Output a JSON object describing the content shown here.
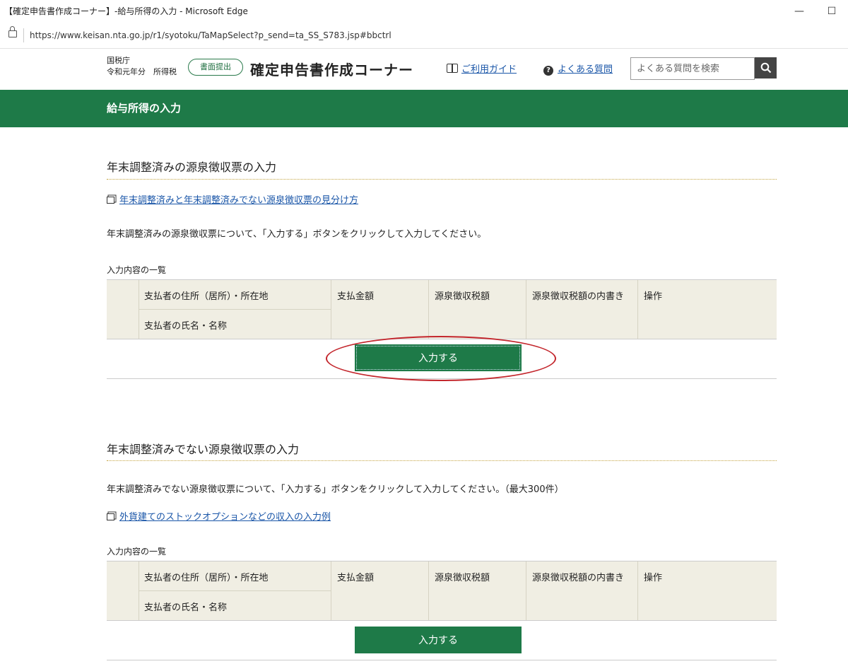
{
  "window": {
    "title": "【確定申告書作成コーナー】-給与所得の入力 - Microsoft Edge",
    "minimize": "—",
    "maximize": "☐",
    "url": "https://www.keisan.nta.go.jp/r1/syotoku/TaMapSelect?p_send=ta_SS_S783.jsp#bbctrl"
  },
  "header": {
    "agency_line1": "国税庁",
    "agency_line2": "令和元年分　所得税",
    "submit_pill": "書面提出",
    "brand": "確定申告書作成コーナー",
    "guide_link": "ご利用ガイド",
    "faq_icon": "?",
    "faq_link": "よくある質問",
    "search_placeholder": "よくある質問を検索"
  },
  "page_title": "給与所得の入力",
  "section1": {
    "title": "年末調整済みの源泉徴収票の入力",
    "link": "年末調整済みと年末調整済みでない源泉徴収票の見分け方",
    "instruction": "年末調整済みの源泉徴収票について、「入力する」ボタンをクリックして入力してください。",
    "table_label": "入力内容の一覧",
    "button": "入力する"
  },
  "section2": {
    "title": "年末調整済みでない源泉徴収票の入力",
    "instruction": "年末調整済みでない源泉徴収票について、「入力する」ボタンをクリックして入力してください。（最大300件）",
    "link": "外貨建てのストックオプションなどの収入の入力例",
    "table_label": "入力内容の一覧",
    "button": "入力する"
  },
  "table_headers": {
    "address": "支払者の住所（居所）・所在地",
    "name": "支払者の氏名・名称",
    "amount": "支払金額",
    "tax": "源泉徴収税額",
    "tax_breakdown": "源泉徴収税額の内書き",
    "action": "操作"
  },
  "colors": {
    "brand_green": "#1e7a48",
    "link_blue": "#1a56a8",
    "highlight_red": "#c3262c",
    "table_bg": "#f0eee3"
  }
}
